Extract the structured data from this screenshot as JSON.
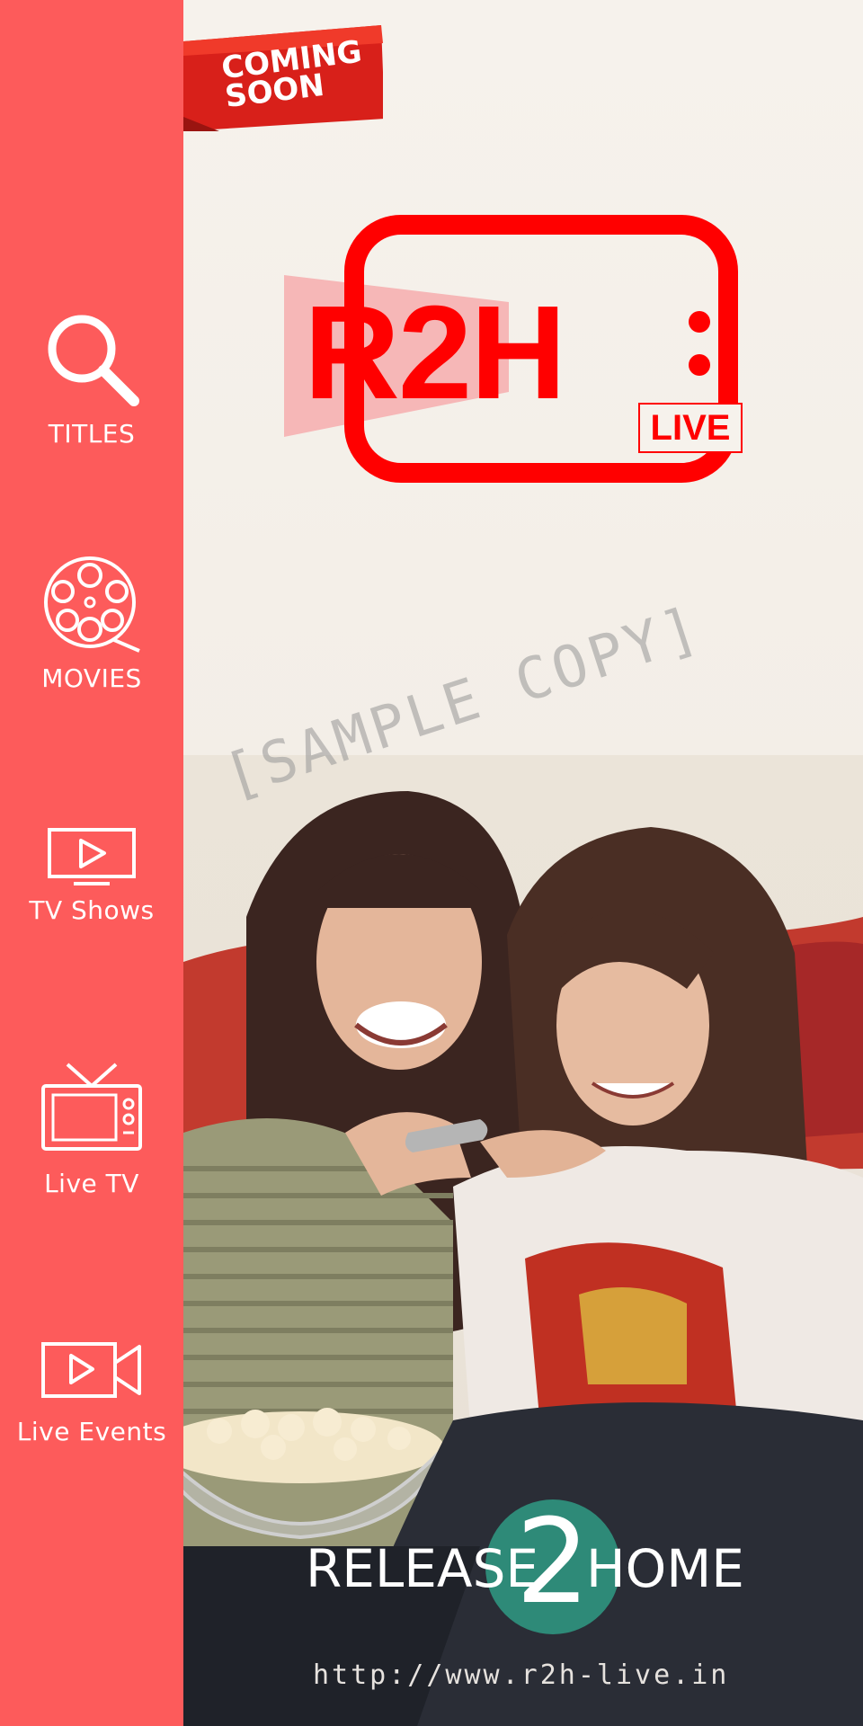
{
  "ribbon": {
    "text": "COMING SOON",
    "color": "#d8201a"
  },
  "sidebar": {
    "background": "#fd5b5b",
    "items": [
      {
        "label": "TITLES",
        "icon": "search-icon"
      },
      {
        "label": "MOVIES",
        "icon": "film-reel-icon"
      },
      {
        "label": "TV Shows",
        "icon": "play-screen-icon"
      },
      {
        "label": "Live TV",
        "icon": "tv-antenna-icon"
      },
      {
        "label": "Live Events",
        "icon": "video-camera-icon"
      }
    ]
  },
  "logo": {
    "main": "R2H",
    "badge": "LIVE",
    "color": "#ff0000"
  },
  "watermark": "[SAMPLE COPY]",
  "brand": {
    "left": "RELEASE",
    "number": "2",
    "right": "HOME",
    "accent": "#f08aa0",
    "circle_color": "#2e8a78"
  },
  "url": "http://www.r2h-live.in"
}
